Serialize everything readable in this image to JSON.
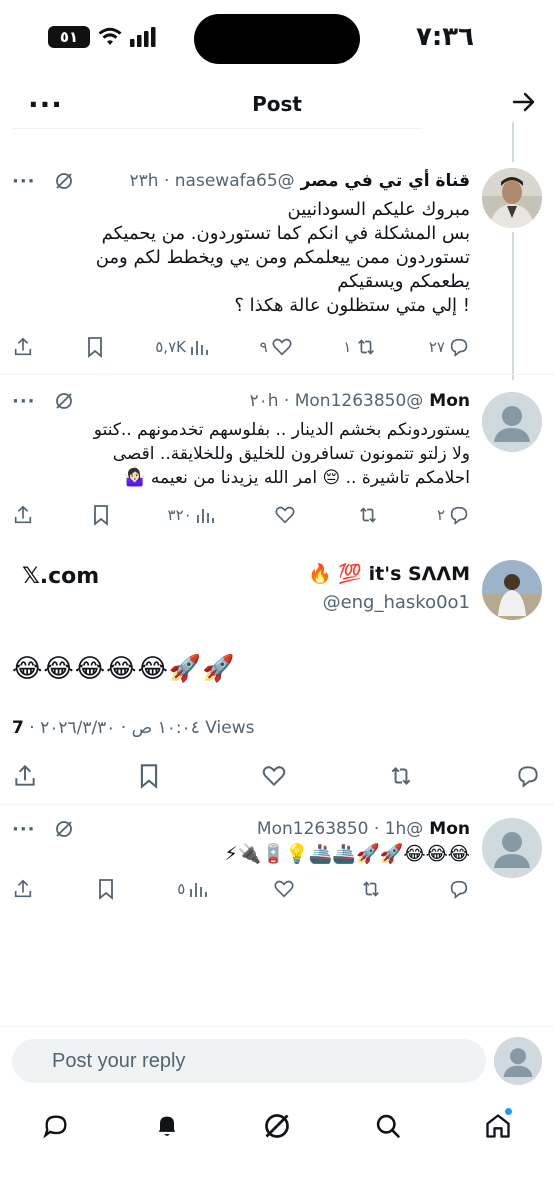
{
  "status_bar": {
    "time": "٧:٣٦",
    "battery": "٥١"
  },
  "header": {
    "title": "Post",
    "more_icon": "more-dots-icon",
    "forward_icon": "arrow-right-icon"
  },
  "replies": [
    {
      "name": "قناة أي تي في مصر",
      "handle": "@nasewafa65",
      "time": "٢٣h",
      "lines": [
        "مبروك عليكم السودانيين",
        "بس المشكلة في انكم كما تستوردون. من يحميكم",
        "تستوردون ممن ييعلمكم ومن يي ويخطط لكم ومن",
        "يطعمكم ويسقيكم",
        "! إلي متي ستظلون عالة هكذا ؟"
      ],
      "replies": "٢٧",
      "reposts": "١",
      "likes": "٩",
      "views": "٥,٧K"
    },
    {
      "name": "Mon",
      "handle": "@Mon1263850",
      "time": "٢٠h",
      "lines": [
        "يستوردونكم بخشم الدينار .. بفلوسهم تخدمونهم ..كنتو",
        "ولا زلتو تتمونون تسافرون  للخليق وللخلايقة.. اقصى",
        "احلامكم تاشيرة .. 😔 امر الله يزيدنا من نعيمه 🤷🏻‍♀️"
      ],
      "replies": "٢",
      "reposts": "",
      "likes": "",
      "views": "٣٢٠"
    }
  ],
  "main_post": {
    "name": "it's SΛΛM 💯 🔥",
    "handle": "@eng_hasko0o1",
    "source_link": "𝕏.com",
    "text": "😂😂😂😂😂🚀🚀",
    "timestamp": "١٠:٠٤ ص · ٢٠٢٦/٣/٣٠",
    "views_count": "7",
    "views_label": "Views"
  },
  "last_reply": {
    "name": "Mon",
    "handle": "@Mon1263850",
    "time": "1h",
    "text": "😂😂😂🚀🚀🚢🚢💡🪫🔌⚡",
    "replies": "",
    "reposts": "",
    "likes": "",
    "views": "٥"
  },
  "composer": {
    "placeholder": "Post your reply"
  },
  "tabbar": [
    "home-icon",
    "search-icon",
    "grok-icon",
    "notifications-icon",
    "messages-icon"
  ],
  "colors": {
    "accent": "#1d9bf0",
    "text": "#0f1419",
    "muted": "#536471",
    "divider": "#eff3f4"
  }
}
